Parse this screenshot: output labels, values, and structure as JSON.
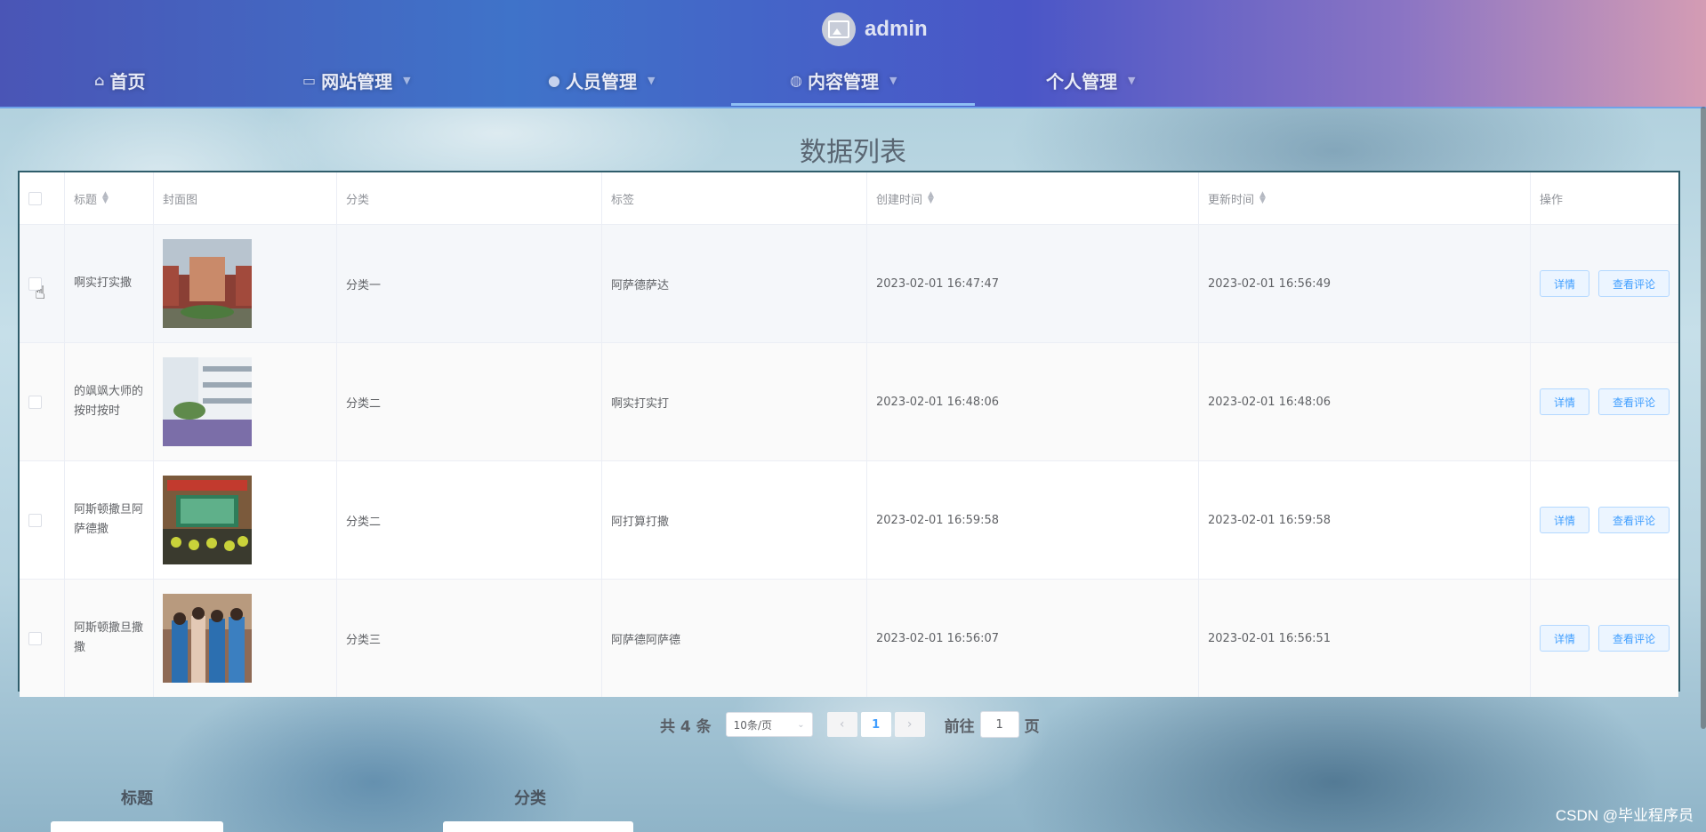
{
  "header": {
    "username": "admin",
    "nav": [
      {
        "label": "首页",
        "icon": "home-icon"
      },
      {
        "label": "网站管理",
        "icon": "monitor-icon"
      },
      {
        "label": "人员管理",
        "icon": "user-icon"
      },
      {
        "label": "内容管理",
        "icon": "chat-icon",
        "active": true
      },
      {
        "label": "个人管理",
        "icon": ""
      }
    ]
  },
  "page": {
    "title": "数据列表"
  },
  "table": {
    "columns": [
      "标题",
      "封面图",
      "分类",
      "标签",
      "创建时间",
      "更新时间",
      "操作"
    ],
    "rows": [
      {
        "title": "啊实打实撒",
        "category": "分类一",
        "tags": "阿萨德萨达",
        "created": "2023-02-01 16:47:47",
        "updated": "2023-02-01 16:56:49"
      },
      {
        "title": "的飒飒大师的按时按时",
        "category": "分类二",
        "tags": "啊实打实打",
        "created": "2023-02-01 16:48:06",
        "updated": "2023-02-01 16:48:06"
      },
      {
        "title": "阿斯顿撒旦阿萨德撒",
        "category": "分类二",
        "tags": "阿打算打撒",
        "created": "2023-02-01 16:59:58",
        "updated": "2023-02-01 16:59:58"
      },
      {
        "title": "阿斯顿撒旦撒撒",
        "category": "分类三",
        "tags": "阿萨德阿萨德",
        "created": "2023-02-01 16:56:07",
        "updated": "2023-02-01 16:56:51"
      }
    ],
    "actions": {
      "detail": "详情",
      "comments": "查看评论"
    }
  },
  "pagination": {
    "total_text": "共 4 条",
    "page_size": "10条/页",
    "current_page": "1",
    "goto_label": "前往",
    "goto_value": "1",
    "page_suffix": "页"
  },
  "filters": {
    "title_label": "标题",
    "category_label": "分类"
  },
  "watermark": "CSDN @毕业程序员",
  "colors": {
    "accent": "#409eff",
    "header_start": "#4a55b6",
    "header_end": "#d49cb4"
  }
}
